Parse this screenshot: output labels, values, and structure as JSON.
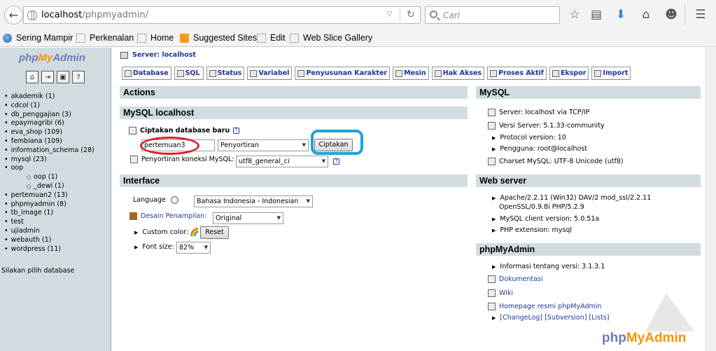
{
  "browser": {
    "url_host": "localhost",
    "url_path": "/phpmyadmin/",
    "search_placeholder": "Cari",
    "bookmarks": [
      "Sering Mampir",
      "Perkenalan",
      "Home",
      "Suggested Sites",
      "Edit",
      "Web Slice Gallery"
    ]
  },
  "sidebar": {
    "logo_php": "php",
    "logo_my": "My",
    "logo_admin": "Admin",
    "databases": [
      {
        "label": "akademik (1)",
        "sub": false
      },
      {
        "label": "cdcol (1)",
        "sub": false
      },
      {
        "label": "db_penggajian (3)",
        "sub": false
      },
      {
        "label": "epaymagribi (6)",
        "sub": false
      },
      {
        "label": "eva_shop (109)",
        "sub": false
      },
      {
        "label": "fembiana (109)",
        "sub": false
      },
      {
        "label": "information_schema (28)",
        "sub": false
      },
      {
        "label": "mysql (23)",
        "sub": false
      },
      {
        "label": "oop",
        "sub": false
      },
      {
        "label": "oop (1)",
        "sub": true
      },
      {
        "label": "_dewi (1)",
        "sub": true
      },
      {
        "label": "pertemuan2 (13)",
        "sub": false
      },
      {
        "label": "phpmyadmin (8)",
        "sub": false
      },
      {
        "label": "tb_image (1)",
        "sub": false
      },
      {
        "label": "test",
        "sub": false
      },
      {
        "label": "ujiadmin",
        "sub": false
      },
      {
        "label": "webauth (1)",
        "sub": false
      },
      {
        "label": "wordpress (11)",
        "sub": false
      }
    ],
    "message": "Silakan pilih database"
  },
  "main": {
    "server_label": "Server: localhost",
    "tabs": [
      "Database",
      "SQL",
      "Status",
      "Variabel",
      "Penyusunan Karakter",
      "Mesin",
      "Hak Akses",
      "Proses Aktif",
      "Ekspor",
      "Import"
    ],
    "actions_title": "Actions",
    "mysql_local_title": "MySQL localhost",
    "create_db_label": "Ciptakan database baru",
    "create_db_value": "pertemuan3",
    "collation_placeholder": "Penyortiran",
    "create_button": "Ciptakan",
    "conn_collation_label": "Penyortiran koneksi MySQL:",
    "conn_collation_value": "utf8_general_ci",
    "interface_title": "Interface",
    "language_label": "Language",
    "language_value": "Bahasa Indonesia - Indonesian",
    "theme_label": "Desain Penampilan:",
    "theme_value": "Original",
    "custom_color_label": "Custom color:",
    "reset_button": "Reset",
    "font_size_label": "Font size:",
    "font_size_value": "82%"
  },
  "mysql_panel": {
    "title": "MySQL",
    "server": "Server: localhost via TCP/IP",
    "version": "Versi Server: 5.1.33-community",
    "protocol": "Protocol version: 10",
    "user": "Pengguna: root@localhost",
    "charset": "Charset MySQL: UTF-8 Unicode (utf8)"
  },
  "webserver_panel": {
    "title": "Web server",
    "apache_line1": "Apache/2.2.11 (Win32) DAV/2 mod_ssl/2.2.11",
    "apache_line2": "OpenSSL/0.9.8i PHP/5.2.9",
    "client": "MySQL client version: 5.0.51a",
    "php_ext": "PHP extension: mysql"
  },
  "pma_panel": {
    "title": "phpMyAdmin",
    "version": "Informasi tentang versi: 3.1.3.1",
    "docs": "Dokumentasi",
    "wiki": "Wiki",
    "homepage": "Homepage resmi phpMyAdmin",
    "changelog": "[ChangeLog]",
    "subversion": "[Subversion]",
    "lists": "[Lists]"
  },
  "watermark": {
    "php": "php",
    "my": "MyAdmin"
  }
}
